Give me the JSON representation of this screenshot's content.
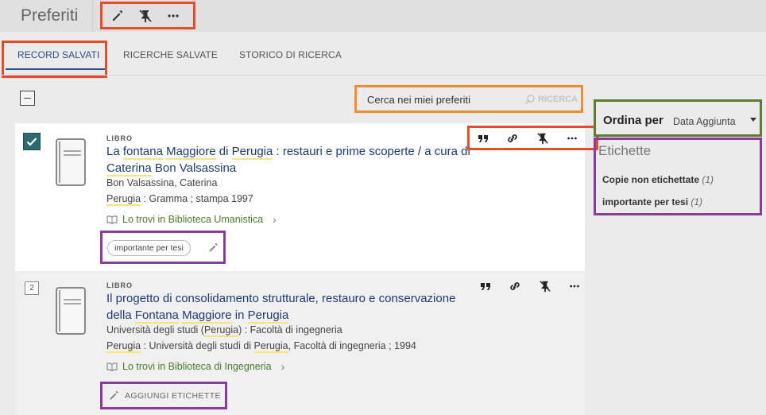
{
  "header": {
    "title": "Preferiti"
  },
  "tabs": [
    {
      "label": "RECORD SALVATI"
    },
    {
      "label": "RICERCHE SALVATE"
    },
    {
      "label": "STORICO DI RICERCA"
    }
  ],
  "search": {
    "placeholder": "Cerca nei miei preferiti",
    "button_label": "RICERCA"
  },
  "records": [
    {
      "type": "LIBRO",
      "title_parts": [
        "La ",
        "fontana",
        " ",
        "Maggiore",
        " di ",
        "Perugia",
        " : restauri e prime scoperte / a cura di ",
        "Caterina",
        " ",
        "Bon Valsassina"
      ],
      "author": "Bon Valsassina, Caterina",
      "pub_parts": [
        "Perugia",
        " : Gramma ; stampa 1997"
      ],
      "availability": "Lo trovi in Biblioteca Umanistica",
      "tag": "importante per tesi",
      "selected": true
    },
    {
      "number": "2",
      "type": "LIBRO",
      "title_parts": [
        "Il progetto di consolidamento strutturale, restauro e conservazione della ",
        "Fontana",
        " ",
        "Maggiore",
        " in ",
        "Perugia"
      ],
      "author_parts": [
        "Università degli studi (",
        "Perugia",
        ") : Facoltà di ingegneria"
      ],
      "pub_parts": [
        "Perugia",
        " : Università degli studi di ",
        "Perugia",
        ", Facoltà di ingegneria ; 1994"
      ],
      "availability": "Lo trovi in Biblioteca di Ingegneria",
      "add_tag_label": "AGGIUNGI ETICHETTE",
      "selected": false
    }
  ],
  "sort": {
    "label": "Ordina per",
    "value": "Data Aggiunta"
  },
  "labels": {
    "title": "Etichette",
    "items": [
      {
        "name": "Copie non etichettate",
        "count": "(1)"
      },
      {
        "name": "importante per tesi",
        "count": "(1)"
      }
    ]
  }
}
